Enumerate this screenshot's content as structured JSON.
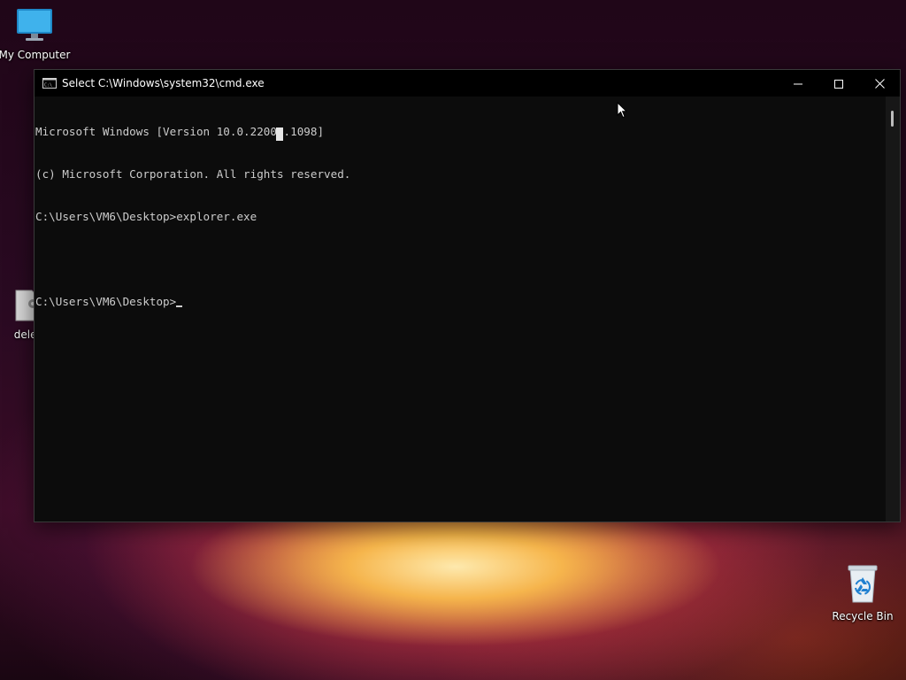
{
  "desktop": {
    "icons": [
      {
        "label": "My Computer",
        "icon": "monitor-icon"
      },
      {
        "label": "delet",
        "icon": "settings-file-icon"
      },
      {
        "label": "Recycle Bin",
        "icon": "recycle-bin-icon"
      }
    ]
  },
  "window": {
    "title": "Select C:\\Windows\\system32\\cmd.exe",
    "app_icon": "console-icon",
    "controls": {
      "minimize": "minimize-icon",
      "maximize": "maximize-icon",
      "close": "close-icon"
    }
  },
  "console": {
    "lines": [
      "Microsoft Windows [Version 10.0.22000.1098]",
      "(c) Microsoft Corporation. All rights reserved.",
      "C:\\Users\\VM6\\Desktop>explorer.exe",
      "",
      "C:\\Users\\VM6\\Desktop>"
    ]
  },
  "colors": {
    "console_bg": "#0c0c0c",
    "console_text": "#cccccc",
    "titlebar_bg": "#000000"
  }
}
